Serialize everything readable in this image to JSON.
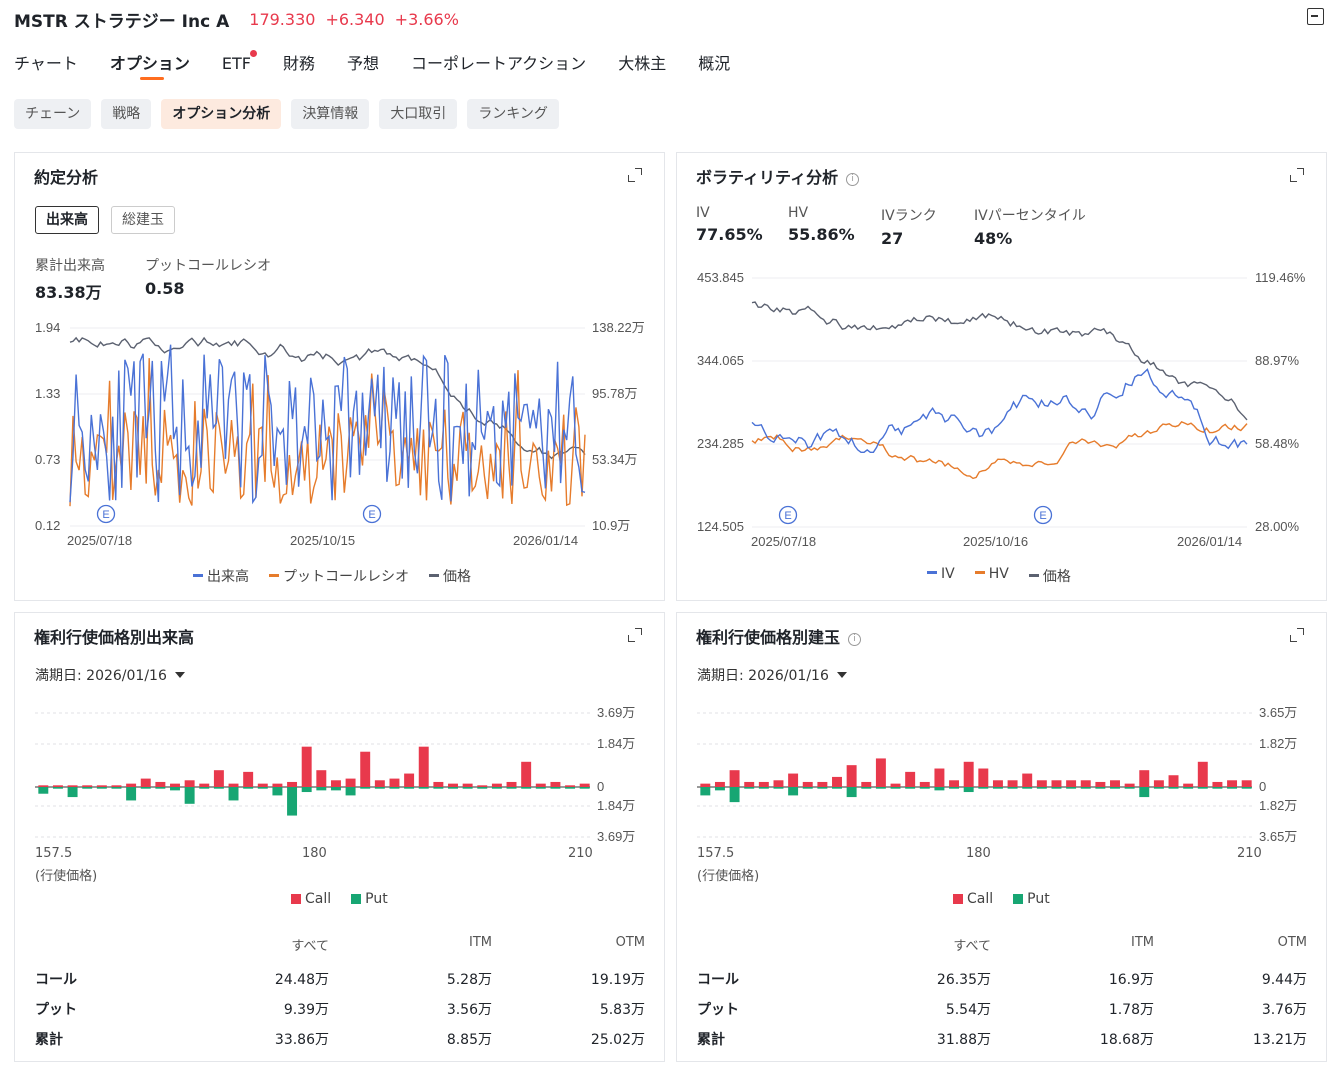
{
  "header": {
    "name": "MSTR ストラテジー Inc A",
    "price": "179.330",
    "change": "+6.340",
    "pct": "+3.66%"
  },
  "tabs": [
    "チャート",
    "オプション",
    "ETF",
    "財務",
    "予想",
    "コーポレートアクション",
    "大株主",
    "概況"
  ],
  "subtabs": [
    "チェーン",
    "戦略",
    "オプション分析",
    "決算情報",
    "大口取引",
    "ランキング"
  ],
  "trade": {
    "title": "約定分析",
    "toggle_volume": "出来高",
    "toggle_oi": "総建玉",
    "stat1_label": "累計出来高",
    "stat1_value": "83.38万",
    "stat2_label": "プットコールレシオ",
    "stat2_value": "0.58",
    "left_axis": [
      "1.94",
      "1.33",
      "0.73",
      "0.12"
    ],
    "right_axis": [
      "138.22万",
      "95.78万",
      "53.34万",
      "10.9万"
    ],
    "dates": [
      "2025/07/18",
      "2025/10/15",
      "2026/01/14"
    ],
    "earnings_marker": "E",
    "legend": [
      "出来高",
      "プットコールレシオ",
      "価格"
    ],
    "colors": [
      "#4a72d6",
      "#e67c2c",
      "#5b6170"
    ]
  },
  "vol": {
    "title": "ボラティリティ分析",
    "stats": [
      {
        "label": "IV",
        "value": "77.65%"
      },
      {
        "label": "HV",
        "value": "55.86%"
      },
      {
        "label": "IVランク",
        "value": "27"
      },
      {
        "label": "IVパーセンタイル",
        "value": "48%"
      }
    ],
    "left_axis": [
      "453.845",
      "344.065",
      "234.285",
      "124.505"
    ],
    "right_axis": [
      "119.46%",
      "88.97%",
      "58.48%",
      "28.00%"
    ],
    "dates": [
      "2025/07/18",
      "2025/10/16",
      "2026/01/14"
    ],
    "earnings_marker": "E",
    "legend": [
      "IV",
      "HV",
      "価格"
    ]
  },
  "strike_vol": {
    "title": "権利行使価格別出来高",
    "expiry_label": "満期日:",
    "expiry": "2026/01/16",
    "axis": [
      "3.69万",
      "1.84万",
      "0",
      "1.84万",
      "3.69万"
    ],
    "x_labels": [
      "157.5",
      "180",
      "210"
    ],
    "x_caption": "(行使価格)",
    "legend": [
      "Call",
      "Put"
    ],
    "table": {
      "headers": [
        "すべて",
        "ITM",
        "OTM"
      ],
      "rows": [
        {
          "label": "コール",
          "v": [
            "24.48万",
            "5.28万",
            "19.19万"
          ]
        },
        {
          "label": "プット",
          "v": [
            "9.39万",
            "3.56万",
            "5.83万"
          ]
        },
        {
          "label": "累計",
          "v": [
            "33.86万",
            "8.85万",
            "25.02万"
          ]
        }
      ]
    }
  },
  "strike_oi": {
    "title": "権利行使価格別建玉",
    "expiry_label": "満期日:",
    "expiry": "2026/01/16",
    "axis": [
      "3.65万",
      "1.82万",
      "0",
      "1.82万",
      "3.65万"
    ],
    "x_labels": [
      "157.5",
      "180",
      "210"
    ],
    "x_caption": "(行使価格)",
    "legend": [
      "Call",
      "Put"
    ],
    "table": {
      "headers": [
        "すべて",
        "ITM",
        "OTM"
      ],
      "rows": [
        {
          "label": "コール",
          "v": [
            "26.35万",
            "16.9万",
            "9.44万"
          ]
        },
        {
          "label": "プット",
          "v": [
            "5.54万",
            "1.78万",
            "3.76万"
          ]
        },
        {
          "label": "累計",
          "v": [
            "31.88万",
            "18.68万",
            "13.21万"
          ]
        }
      ]
    }
  },
  "chart_data": [
    {
      "type": "line",
      "title": "約定分析",
      "x": [
        "2025/07/18",
        "2025/10/15",
        "2026/01/14"
      ],
      "ylim_left": [
        0.12,
        1.94
      ],
      "ylim_right": [
        "10.9万",
        "138.22万"
      ],
      "series": [
        {
          "name": "出来高"
        },
        {
          "name": "プットコールレシオ"
        },
        {
          "name": "価格"
        }
      ]
    },
    {
      "type": "line",
      "title": "ボラティリティ分析",
      "x": [
        "2025/07/18",
        "2025/10/16",
        "2026/01/14"
      ],
      "ylim_left": [
        124.505,
        453.845
      ],
      "ylim_right": [
        "28.00%",
        "119.46%"
      ],
      "series": [
        {
          "name": "IV"
        },
        {
          "name": "HV"
        },
        {
          "name": "価格"
        }
      ]
    },
    {
      "type": "bar",
      "title": "権利行使価格別出来高",
      "x": [
        "157.5",
        "180",
        "210"
      ],
      "ylim": [
        "-3.69万",
        "3.69万"
      ],
      "series": [
        {
          "name": "Call",
          "values": [
            0.1,
            0.1,
            0.1,
            0.1,
            0.1,
            0.1,
            0.2,
            0.5,
            0.3,
            0.2,
            0.4,
            0.2,
            1.0,
            0.2,
            0.9,
            0.2,
            0.2,
            0.3,
            2.4,
            1.0,
            0.4,
            0.5,
            2.1,
            0.4,
            0.5,
            0.8,
            2.4,
            0.3,
            0.2,
            0.2,
            0.1,
            0.2,
            0.3,
            1.5,
            0.2,
            0.3,
            0.1,
            0.2
          ]
        },
        {
          "name": "Put",
          "values": [
            -0.4,
            -0.1,
            -0.6,
            -0.1,
            -0.1,
            -0.1,
            -0.8,
            -0.1,
            -0.1,
            -0.2,
            -1.0,
            -0.1,
            -0.1,
            -0.8,
            -0.1,
            -0.1,
            -0.5,
            -1.7,
            -0.3,
            -0.2,
            -0.2,
            -0.5,
            -0.1,
            -0.1,
            -0.1,
            -0.1,
            -0.1,
            -0.1,
            -0.1,
            -0.1,
            -0.1,
            -0.1,
            -0.1,
            -0.1,
            -0.1,
            -0.1,
            -0.1,
            -0.1
          ]
        }
      ]
    },
    {
      "type": "bar",
      "title": "権利行使価格別建玉",
      "x": [
        "157.5",
        "180",
        "210"
      ],
      "ylim": [
        "-3.65万",
        "3.65万"
      ],
      "series": [
        {
          "name": "Call",
          "values": [
            0.2,
            0.3,
            1.0,
            0.3,
            0.3,
            0.4,
            0.8,
            0.3,
            0.3,
            0.6,
            1.3,
            0.3,
            1.7,
            0.2,
            0.9,
            0.3,
            1.1,
            0.4,
            1.5,
            1.1,
            0.4,
            0.4,
            0.8,
            0.4,
            0.4,
            0.4,
            0.4,
            0.3,
            0.4,
            0.2,
            1.0,
            0.4,
            0.7,
            0.2,
            1.5,
            0.3,
            0.4,
            0.4
          ]
        },
        {
          "name": "Put",
          "values": [
            -0.5,
            -0.2,
            -0.9,
            -0.1,
            -0.1,
            -0.1,
            -0.5,
            -0.1,
            -0.1,
            -0.1,
            -0.6,
            -0.1,
            -0.1,
            -0.1,
            -0.1,
            -0.1,
            -0.2,
            -0.1,
            -0.3,
            -0.1,
            -0.1,
            -0.1,
            -0.1,
            -0.1,
            -0.1,
            -0.1,
            -0.1,
            -0.1,
            -0.1,
            -0.1,
            -0.6,
            -0.1,
            -0.1,
            -0.1,
            -0.1,
            -0.1,
            -0.1,
            -0.1
          ]
        }
      ]
    }
  ]
}
